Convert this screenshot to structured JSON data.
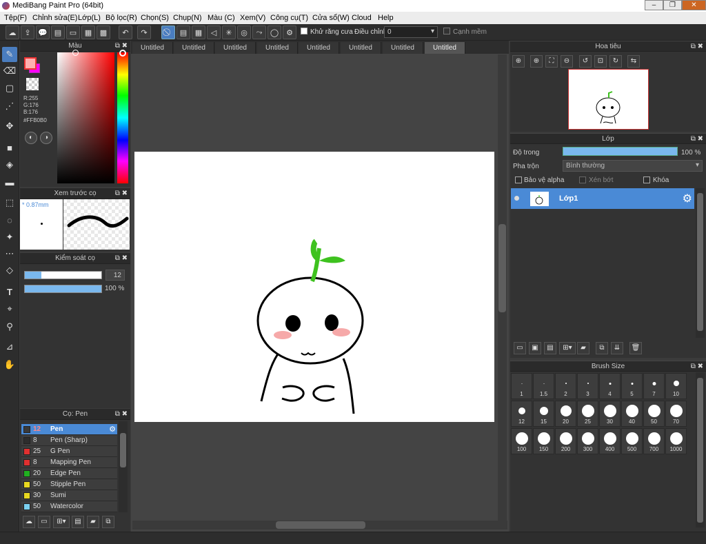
{
  "window": {
    "title": "MediBang Paint Pro (64bit)",
    "minimize": "–",
    "restore": "❐",
    "close": "✕"
  },
  "menu": [
    "Tệp(F)",
    "Chỉnh sửa(E)",
    "Lớp(L)",
    "Bộ lọc(R)",
    "Chọn(S)",
    "Chụp(N)",
    "Màu (C)",
    "Xem(V)",
    "Công cụ(T)",
    "Cửa sổ(W)",
    "Cloud",
    "Help"
  ],
  "toolbar": {
    "antialias_label": "Khử răng cưa",
    "adjust_label": "Điều chỉnh",
    "adjust_value": "0",
    "edge_label": "Cạnh mềm"
  },
  "panels": {
    "color": "Màu",
    "brush_preview": "Xem trước cọ",
    "brush_control": "Kiểm soát cọ",
    "brush_list": "Cọ: Pen",
    "navigator": "Hoa tiêu",
    "layer": "Lớp",
    "brush_size": "Brush Size"
  },
  "color": {
    "r": "R:255",
    "g": "G:176",
    "b": "B:176",
    "hex": "#FFB0B0",
    "fg": "#FFB0B0",
    "bg": "#FF00FF"
  },
  "brush_preview": {
    "size": "0.87mm"
  },
  "brush_control": {
    "size": "12",
    "size_fraction": 0.22,
    "opacity": "100 %",
    "opacity_fraction": 1.0
  },
  "brushes": [
    {
      "size": "12",
      "name": "Pen",
      "color": "#3a3a3a",
      "selected": true
    },
    {
      "size": "8",
      "name": "Pen (Sharp)",
      "color": "#2d2d2d"
    },
    {
      "size": "25",
      "name": "G Pen",
      "color": "#e03030"
    },
    {
      "size": "8",
      "name": "Mapping Pen",
      "color": "#e03030"
    },
    {
      "size": "20",
      "name": "Edge Pen",
      "color": "#20b020"
    },
    {
      "size": "50",
      "name": "Stipple Pen",
      "color": "#e8d820"
    },
    {
      "size": "30",
      "name": "Sumi",
      "color": "#e8d820"
    },
    {
      "size": "50",
      "name": "Watercolor",
      "color": "#7ad0f0"
    }
  ],
  "tabs": [
    "Untitled",
    "Untitled",
    "Untitled",
    "Untitled",
    "Untitled",
    "Untitled",
    "Untitled",
    "Untitled"
  ],
  "layer": {
    "opacity_label": "Độ trong",
    "opacity_value": "100 %",
    "blend_label": "Pha trộn",
    "blend_value": "Bình thường",
    "protect_alpha": "Bảo vệ alpha",
    "clipping": "Xén bớt",
    "lock": "Khóa",
    "layer_name": "Lớp1"
  },
  "brush_sizes": [
    "1",
    "1.5",
    "2",
    "3",
    "4",
    "5",
    "7",
    "10",
    "12",
    "15",
    "20",
    "25",
    "30",
    "40",
    "50",
    "70",
    "100",
    "150",
    "200",
    "300",
    "400",
    "500",
    "700",
    "1000"
  ]
}
